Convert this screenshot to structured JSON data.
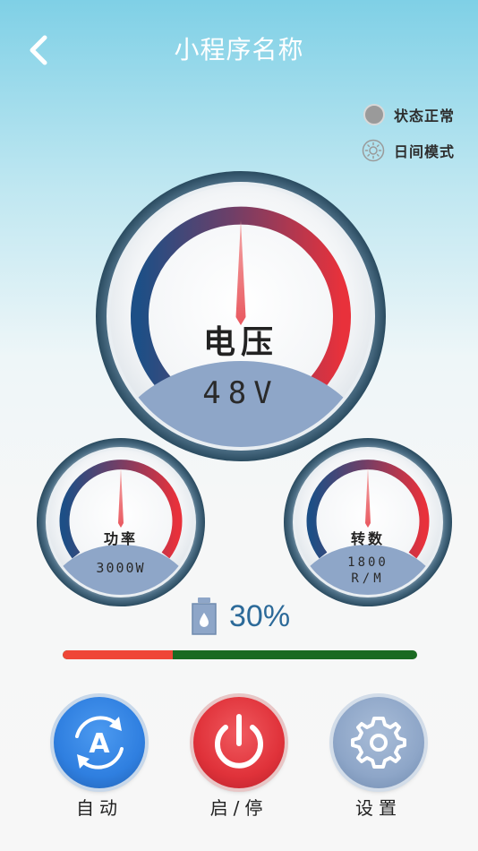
{
  "header": {
    "title": "小程序名称",
    "back_icon": "chevron-left-icon"
  },
  "status": {
    "state_label": "状态正常",
    "mode_label": "日间模式"
  },
  "gauges": {
    "voltage": {
      "label": "电压",
      "value": "48V"
    },
    "power": {
      "label": "功率",
      "value": "3000W"
    },
    "speed": {
      "label": "转数",
      "value_line1": "1800",
      "value_line2": "R/M"
    }
  },
  "fuel": {
    "icon": "fuel-can-icon",
    "percent_text": "30%",
    "level": 0.31
  },
  "controls": {
    "auto_label": "自动",
    "power_label": "启/停",
    "settings_label": "设置"
  },
  "colors": {
    "auto": "#2f7fe0",
    "power": "#e0323a",
    "settings": "#8ea6c8",
    "progress_fill": "#ef4637",
    "progress_track": "#1a6a22"
  }
}
